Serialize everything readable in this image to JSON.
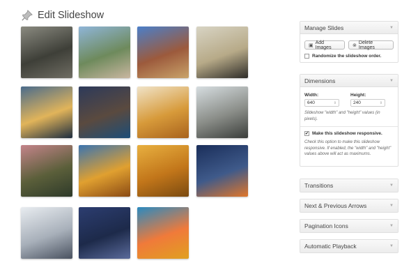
{
  "header": {
    "title": "Edit Slideshow",
    "icon": "pushpin-icon"
  },
  "thumbnails": [
    {
      "name": "misty-lake",
      "colors": [
        "#8a8a80",
        "#3e3f38",
        "#6f6d63"
      ]
    },
    {
      "name": "coastal-village",
      "colors": [
        "#8fb5d8",
        "#6e8a5c",
        "#c9b6a0"
      ]
    },
    {
      "name": "red-mountains",
      "colors": [
        "#4b7fc9",
        "#9c5a3c",
        "#c9a36a"
      ]
    },
    {
      "name": "cliff-sunset",
      "colors": [
        "#d8d4c4",
        "#b7aa88",
        "#2e2c28"
      ]
    },
    {
      "name": "bridge-sunset",
      "colors": [
        "#4a6b8c",
        "#e1b45a",
        "#1d2d3f"
      ]
    },
    {
      "name": "rocky-cove",
      "colors": [
        "#2d3a5a",
        "#5a4a3f",
        "#1c4d78"
      ]
    },
    {
      "name": "autumn-leaves",
      "colors": [
        "#f0e3c8",
        "#d79a3a",
        "#a8621c"
      ]
    },
    {
      "name": "eiffel-tower",
      "colors": [
        "#d6dde0",
        "#8a8d88",
        "#3a3d3a"
      ]
    },
    {
      "name": "river-dusk",
      "colors": [
        "#c4848a",
        "#5b5f3a",
        "#2e3a2a"
      ]
    },
    {
      "name": "golden-tree",
      "colors": [
        "#3b74b0",
        "#e0a030",
        "#8a4a14"
      ]
    },
    {
      "name": "wheat-field",
      "colors": [
        "#e8b040",
        "#c2761a",
        "#7a4a10"
      ]
    },
    {
      "name": "tokyo-night",
      "colors": [
        "#1a2e5a",
        "#3f5a8a",
        "#e0762a"
      ]
    },
    {
      "name": "snowy-forest",
      "colors": [
        "#e8ecf0",
        "#a8b0ba",
        "#4a5260"
      ]
    },
    {
      "name": "blue-lake-night",
      "colors": [
        "#2c3d70",
        "#1d2a4a",
        "#5a6a9a"
      ]
    },
    {
      "name": "orange-flower",
      "colors": [
        "#2a8ac0",
        "#f07a3a",
        "#e0a020"
      ]
    }
  ],
  "manage_slides": {
    "title": "Manage Slides",
    "add_label": "Add Images",
    "delete_label": "Delete Images",
    "randomize_label": "Randomize the slideshow order.",
    "randomize_checked": false
  },
  "dimensions": {
    "title": "Dimensions",
    "width_label": "Width:",
    "width_value": "640",
    "height_label": "Height:",
    "height_value": "240",
    "help": "Slideshow \"width\" and \"height\" values (in pixels).",
    "responsive_label": "Make this slideshow responsive.",
    "responsive_checked": true,
    "responsive_help": "Check this option to make this slideshow responsive. If enabled, the \"width\" and \"height\" values above will act as maximums."
  },
  "closed_panels": [
    {
      "id": "transitions",
      "title": "Transitions"
    },
    {
      "id": "arrows",
      "title": "Next & Previous Arrows"
    },
    {
      "id": "pagination",
      "title": "Pagination Icons"
    },
    {
      "id": "autoplay",
      "title": "Automatic Playback"
    }
  ]
}
